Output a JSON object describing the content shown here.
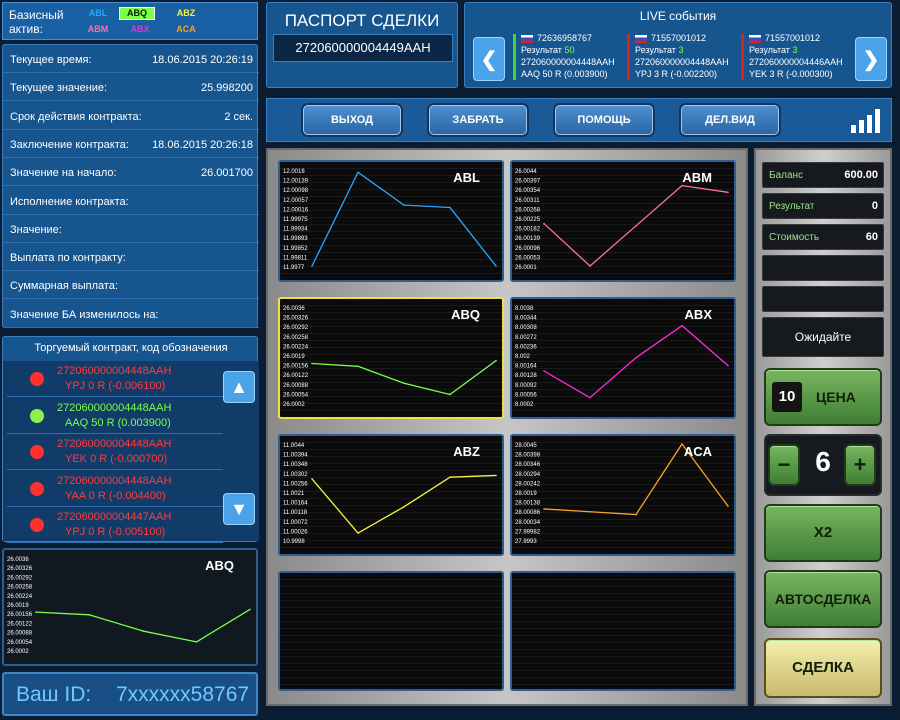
{
  "assets": {
    "label_line1": "Базисный",
    "label_line2": "актив:",
    "items": [
      {
        "name": "ABL",
        "color": "#29a6ff"
      },
      {
        "name": "ABQ",
        "color": "#7dff4a"
      },
      {
        "name": "ABZ",
        "color": "#f5f53a"
      },
      {
        "name": "ABM",
        "color": "#ff6fa8"
      },
      {
        "name": "ABX",
        "color": "#d23ad2"
      },
      {
        "name": "ACA",
        "color": "#ffa02a"
      }
    ]
  },
  "info": [
    {
      "label": "Текущее время:",
      "value": "18.06.2015 20:26:19"
    },
    {
      "label": "Текущее значение:",
      "value": "25.998200"
    },
    {
      "label": "Срок действия контракта:",
      "value": "2 сек."
    },
    {
      "label": "Заключение контракта:",
      "value": "18.06.2015 20:26:18"
    },
    {
      "label": "Значение на начало:",
      "value": "26.001700"
    },
    {
      "label": "Исполнение контракта:",
      "value": ""
    },
    {
      "label": "Значение:",
      "value": ""
    },
    {
      "label": "Выплата по контракту:",
      "value": ""
    },
    {
      "label": "Суммарная выплата:",
      "value": ""
    },
    {
      "label": "Значение БА изменилось на:",
      "value": ""
    }
  ],
  "contracts": {
    "header": "Торгуемый контракт, код обозначения",
    "items": [
      {
        "code": "272060000004448AAH",
        "detail": "YPJ  0 R (-0.006100)",
        "status": "red"
      },
      {
        "code": "272060000004448AAH",
        "detail": "AAQ  50 R (0.003900)",
        "status": "green"
      },
      {
        "code": "272060000004448AAH",
        "detail": "YEK  0 R (-0.000700)",
        "status": "red"
      },
      {
        "code": "272060000004448AAH",
        "detail": "YAA  0 R (-0.004400)",
        "status": "red"
      },
      {
        "code": "272060000004447AAH",
        "detail": "YPJ  0 R (-0.005100)",
        "status": "red"
      }
    ],
    "scroll_up": "▲",
    "scroll_down": "▼"
  },
  "user": {
    "id_label": "Ваш ID:",
    "id_value": "7xxxxxx58767"
  },
  "passport": {
    "title": "ПАСПОРТ СДЕЛКИ",
    "number": "272060000004449AAH"
  },
  "live": {
    "title": "LIVE события",
    "prev": "❮",
    "next": "❯",
    "events": [
      {
        "id": "72636958767",
        "result_label": "Результат",
        "result_value": "50",
        "code": "272060000004448AAH",
        "detail": "AAQ  50 R (0.003900)",
        "bar_color": "#3ad83a"
      },
      {
        "id": "71557001012",
        "result_label": "Результат",
        "result_value": "3",
        "code": "272060000004448AAH",
        "detail": "YPJ  3 R (-0.002200)",
        "bar_color": "#e02020"
      },
      {
        "id": "71557001012",
        "result_label": "Результат",
        "result_value": "3",
        "code": "272060000004446AAH",
        "detail": "YEK  3 R (-0.000300)",
        "bar_color": "#e02020"
      }
    ]
  },
  "toolbar": {
    "exit": "ВЫХОД",
    "take": "ЗАБРАТЬ",
    "help": "ПОМОЩЬ",
    "view": "ДЕЛ.ВИД"
  },
  "right": {
    "balance_label": "Баланс",
    "balance_value": "600.00",
    "result_label": "Результат",
    "result_value": "0",
    "cost_label": "Стоимость",
    "cost_value": "60",
    "status": "Ожидайте",
    "price_value": "10",
    "price_label": "ЦЕНА",
    "minus": "−",
    "qty": "6",
    "plus": "+",
    "x2": "X2",
    "auto": "АВТОСДЕЛКА",
    "deal": "СДЕЛКА"
  },
  "chart_data": [
    {
      "type": "line",
      "title": "ABL",
      "color": "#29a6ff",
      "yticks": [
        "12.0018",
        "12.00139",
        "12.00098",
        "12.00057",
        "12.00016",
        "11.99975",
        "11.99934",
        "11.99893",
        "11.99852",
        "11.99811",
        "11.9977"
      ],
      "ylim": [
        11.9977,
        12.0018
      ],
      "values": [
        11.9977,
        12.0017,
        12.0003,
        12.0002,
        11.9977
      ]
    },
    {
      "type": "line",
      "title": "ABM",
      "color": "#ff6fa8",
      "yticks": [
        "26.0044",
        "26.00397",
        "26.00354",
        "26.00311",
        "26.00268",
        "26.00225",
        "26.00182",
        "26.00139",
        "26.00096",
        "26.00053",
        "26.0001"
      ],
      "ylim": [
        26.0001,
        26.0044
      ],
      "values": [
        26.002,
        26.0001,
        26.0019,
        26.0037,
        26.0034
      ]
    },
    {
      "type": "line",
      "title": "ABQ",
      "color": "#7dff4a",
      "yticks": [
        "26.0036",
        "26.00326",
        "26.00292",
        "26.00258",
        "26.00224",
        "26.0019",
        "26.00156",
        "26.00122",
        "26.00088",
        "26.00054",
        "26.0002"
      ],
      "ylim": [
        26.0002,
        26.0036
      ],
      "values": [
        26.0016,
        26.0015,
        26.0009,
        26.0005,
        26.0017
      ]
    },
    {
      "type": "line",
      "title": "ABX",
      "color": "#ff2ad8",
      "yticks": [
        "8.0038",
        "8.00344",
        "8.00308",
        "8.00272",
        "8.00236",
        "8.002",
        "8.00164",
        "8.00128",
        "8.00092",
        "8.00056",
        "8.0002"
      ],
      "ylim": [
        8.0002,
        8.0038
      ],
      "values": [
        8.0014,
        8.0004,
        8.0019,
        8.0031,
        8.0016
      ]
    },
    {
      "type": "line",
      "title": "ABZ",
      "color": "#f5f53a",
      "yticks": [
        "11.0044",
        "11.00394",
        "11.00348",
        "11.00302",
        "11.00256",
        "11.0021",
        "11.00164",
        "11.00118",
        "11.00072",
        "11.00026",
        "10.9998"
      ],
      "ylim": [
        10.9989,
        11.0044
      ],
      "values": [
        11.0024,
        10.9993,
        11.0008,
        11.0025,
        11.0026
      ]
    },
    {
      "type": "line",
      "title": "ACA",
      "color": "#ffa02a",
      "yticks": [
        "28.0045",
        "28.00398",
        "28.00346",
        "28.00294",
        "28.00242",
        "28.0019",
        "28.00138",
        "28.00086",
        "28.00034",
        "27.99982",
        "27.9993"
      ],
      "ylim": [
        28.0011,
        28.0045
      ],
      "values": [
        28.0022,
        28.0021,
        28.002,
        28.0045,
        28.0023
      ]
    },
    {
      "type": "line",
      "title": "ABQ",
      "color": "#7dff4a",
      "yticks": [
        "26.0036",
        "26.00326",
        "26.00292",
        "26.00258",
        "26.00224",
        "26.0019",
        "26.00156",
        "26.00122",
        "26.00088",
        "26.00054",
        "26.0002"
      ],
      "ylim": [
        26.0002,
        26.0036
      ],
      "values": [
        26.0016,
        26.0015,
        26.0009,
        26.0005,
        26.0017
      ]
    }
  ]
}
